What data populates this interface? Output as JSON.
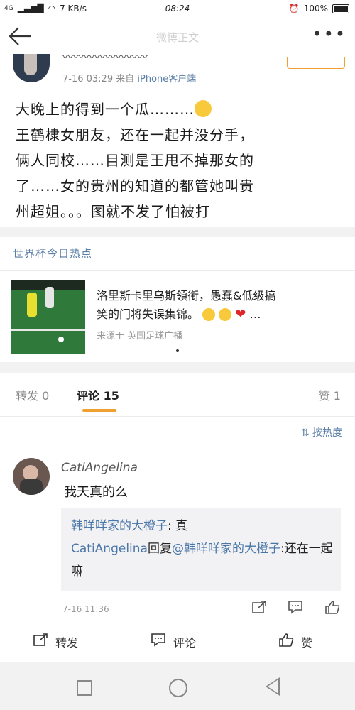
{
  "status_bar": {
    "signal": "4G",
    "speed": "7 KB/s",
    "time": "08:24",
    "battery": "100%"
  },
  "nav": {
    "title": "微博正文",
    "more": "•••"
  },
  "post": {
    "meta_time": "7-16 03:29",
    "meta_from": "来自",
    "meta_source": "iPhone客户端",
    "content_lines": [
      "大晚上的得到一个瓜………",
      "王鹤棣女朋友，还在一起并没分手，",
      "俩人同校……目测是王甩不掉那女的",
      "了……女的贵州的知道的都管她叫贵",
      "州超姐。。。图就不发了怕被打"
    ]
  },
  "hot": {
    "section_title": "世界杯今日热点",
    "headline_line1": "洛里斯卡里乌斯領衔，愚蠢&低级搞",
    "headline_line2": "笑的门将失误集锦。",
    "headline_tail": "…",
    "source": "来源于 英国足球广播"
  },
  "tabs": {
    "repost": "转发 0",
    "comment": "评论 15",
    "like": "赞 1"
  },
  "comments": {
    "sort_label": "按热度",
    "items": [
      {
        "name": "CatiAngelina",
        "text": "我天真的么",
        "reply_name": "韩咩咩家的大橙子",
        "reply_text": ": 真",
        "reply2_name": "CatiAngelina",
        "reply2_mid": "回复",
        "reply2_at": "@韩咩咩家的大橙子",
        "reply2_text": ":还在一起嘛",
        "time": "7-16 11:36"
      }
    ]
  },
  "actions": {
    "repost": "转发",
    "comment": "评论",
    "like": "赞"
  }
}
